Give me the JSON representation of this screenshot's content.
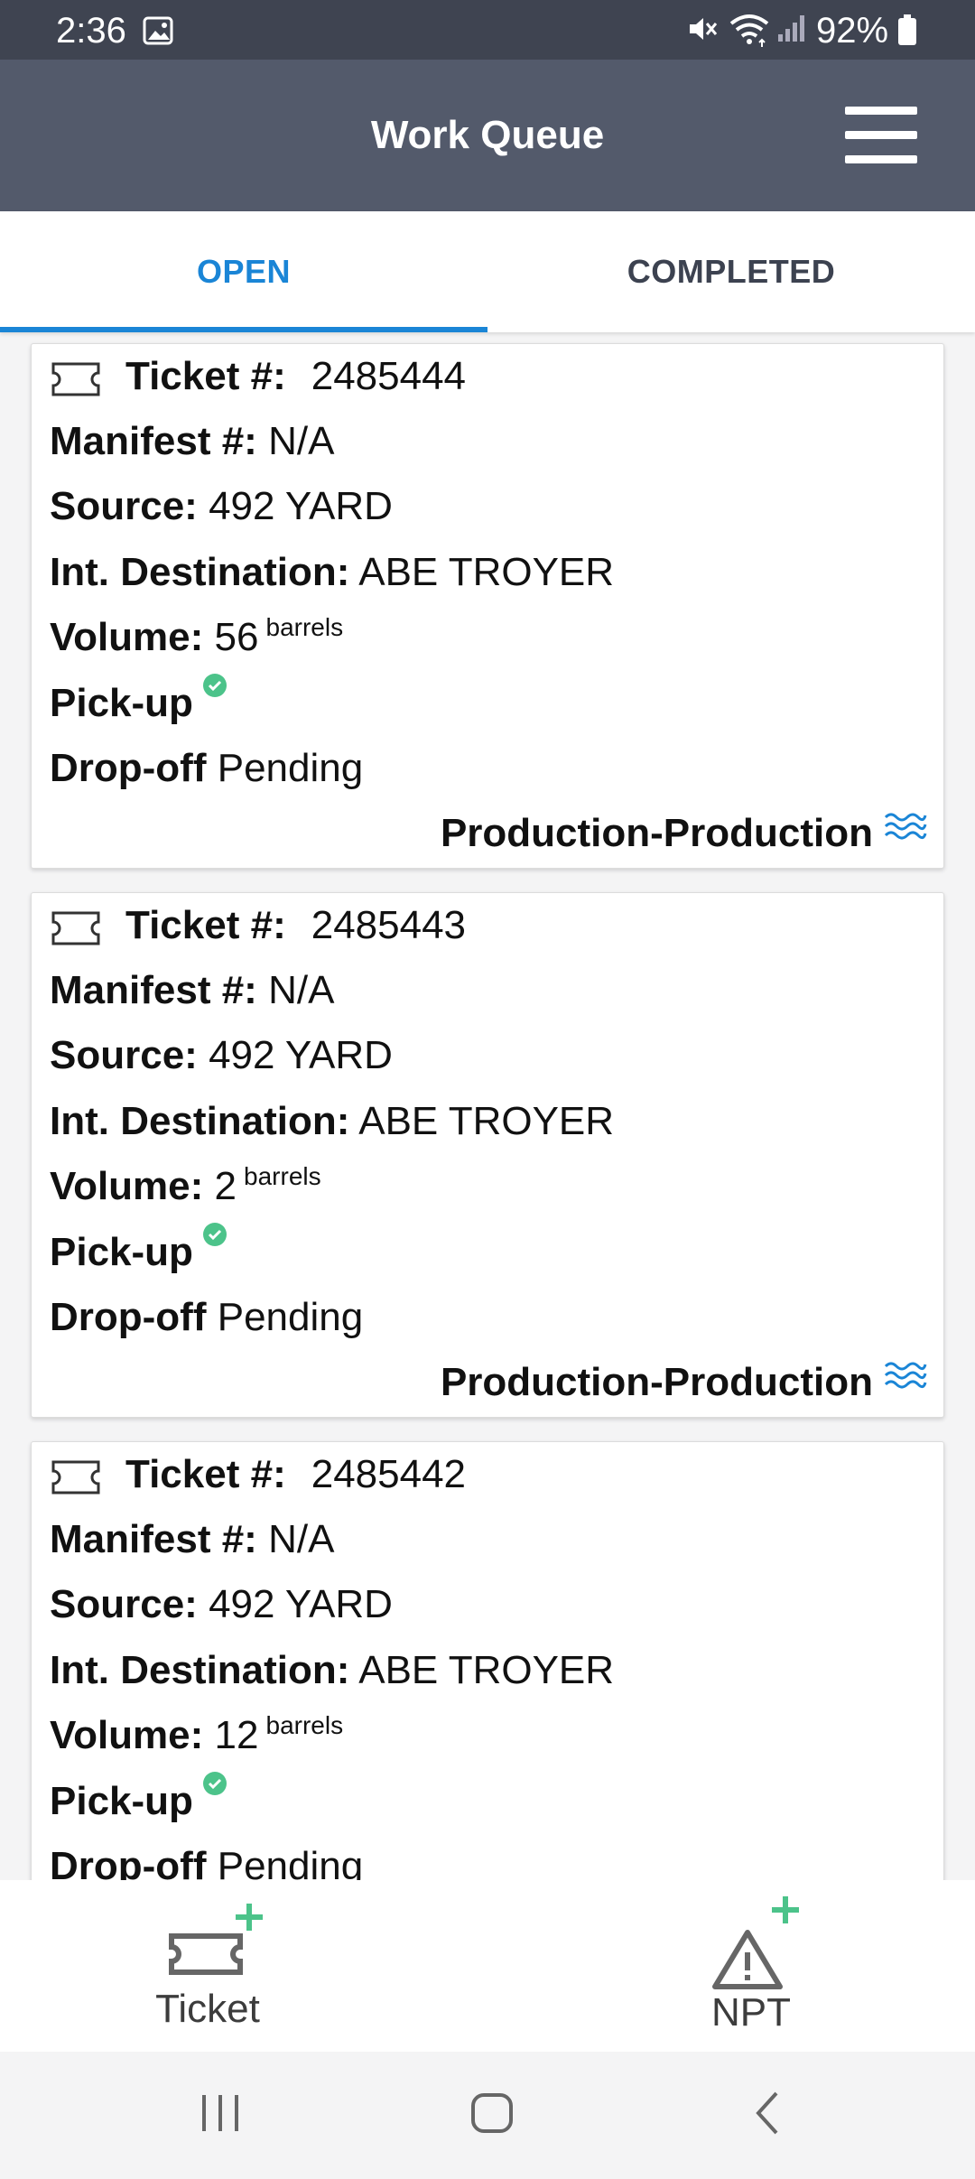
{
  "status_bar": {
    "time": "2:36",
    "battery": "92%",
    "icons": [
      "gallery-icon",
      "mute-icon",
      "wifi-icon",
      "signal-icon",
      "battery-icon"
    ]
  },
  "app_bar": {
    "title": "Work Queue",
    "menu_icon": "hamburger-menu-icon"
  },
  "tabs": [
    {
      "label": "OPEN",
      "selected": true
    },
    {
      "label": "COMPLETED",
      "selected": false
    }
  ],
  "labels": {
    "ticket": "Ticket #:",
    "manifest": "Manifest #:",
    "source": "Source:",
    "int_destination": "Int. Destination:",
    "volume": "Volume:",
    "pickup": "Pick-up",
    "dropoff": "Drop-off"
  },
  "cards": [
    {
      "ticket": "2485444",
      "manifest": "N/A",
      "source": "492 YARD",
      "int_destination": "ABE TROYER",
      "volume": "56",
      "unit": "barrels",
      "pickup_done": true,
      "dropoff": "Pending",
      "type": "Production-Production"
    },
    {
      "ticket": "2485443",
      "manifest": "N/A",
      "source": "492 YARD",
      "int_destination": "ABE TROYER",
      "volume": "2",
      "unit": "barrels",
      "pickup_done": true,
      "dropoff": "Pending",
      "type": "Production-Production"
    },
    {
      "ticket": "2485442",
      "manifest": "N/A",
      "source": "492 YARD",
      "int_destination": "ABE TROYER",
      "volume": "12",
      "unit": "barrels",
      "pickup_done": true,
      "dropoff": "Pending",
      "type": ""
    }
  ],
  "actions": {
    "ticket_label": "Ticket",
    "npt_label": "NPT"
  },
  "colors": {
    "accent": "#1a85d6",
    "appbar": "#535a6b",
    "statusbar": "#3f4451",
    "check": "#4cc38a",
    "plus": "#4cc38a"
  }
}
